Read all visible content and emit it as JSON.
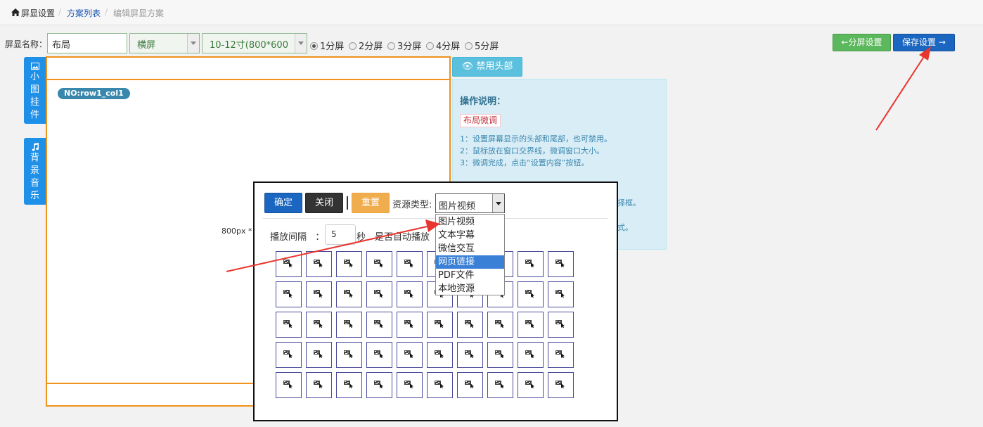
{
  "breadcrumb": {
    "home": "屏显设置",
    "list": "方案列表",
    "current": "编辑屏显方案",
    "sep": "/"
  },
  "toolbar": {
    "name_label": "屏显名称：",
    "name_value": "布局",
    "orientation": "横屏",
    "size": "10-12寸(800*600",
    "radios": [
      "1分屏",
      "2分屏",
      "3分屏",
      "4分屏",
      "5分屏"
    ],
    "selected_radio": "1分屏",
    "split_button": "分屏设置",
    "save_button": "保存设置"
  },
  "side_tabs": {
    "widgets": [
      "小",
      "图",
      "挂",
      "件"
    ],
    "music": [
      "背",
      "景",
      "音",
      "乐"
    ]
  },
  "canvas": {
    "row_badge": "NO:row1_col1",
    "size_text": "800px *"
  },
  "info": {
    "disable_header_button": "禁用头部",
    "title": "操作说明：",
    "tag": "布局微调",
    "lines": [
      "1：设置屏幕显示的头部和尾部，也可禁用。",
      "2：鼠标放在窗口交界线，微调窗口大小。",
      "3：微调完成，点击“设置内容”按钮。"
    ],
    "partial_lines": [
      "择框。",
      "式。"
    ]
  },
  "dialog": {
    "confirm": "确定",
    "close": "关闭",
    "reset": "重置",
    "resource_type_label": "资源类型:",
    "resource_type_value": "图片视频",
    "interval_label": "播放间隔",
    "interval_colon": "：",
    "interval_value": "5",
    "seconds": "秒",
    "auto_label": "是否自动播放",
    "options": [
      "图片视频",
      "文本字幕",
      "微信交互",
      "网页链接",
      "PDF文件",
      "本地资源"
    ],
    "highlighted_option": "网页链接",
    "grid_rows": 5,
    "grid_cols": 10,
    "cell_icon": "broken-image-icon"
  },
  "colors": {
    "accent_orange": "#f0921e",
    "primary_blue": "#1a66c0",
    "success_green": "#5cb85c",
    "info_cyan": "#5bc0de",
    "side_tab_blue": "#1e90e8",
    "annotation_red": "#e8352e"
  }
}
